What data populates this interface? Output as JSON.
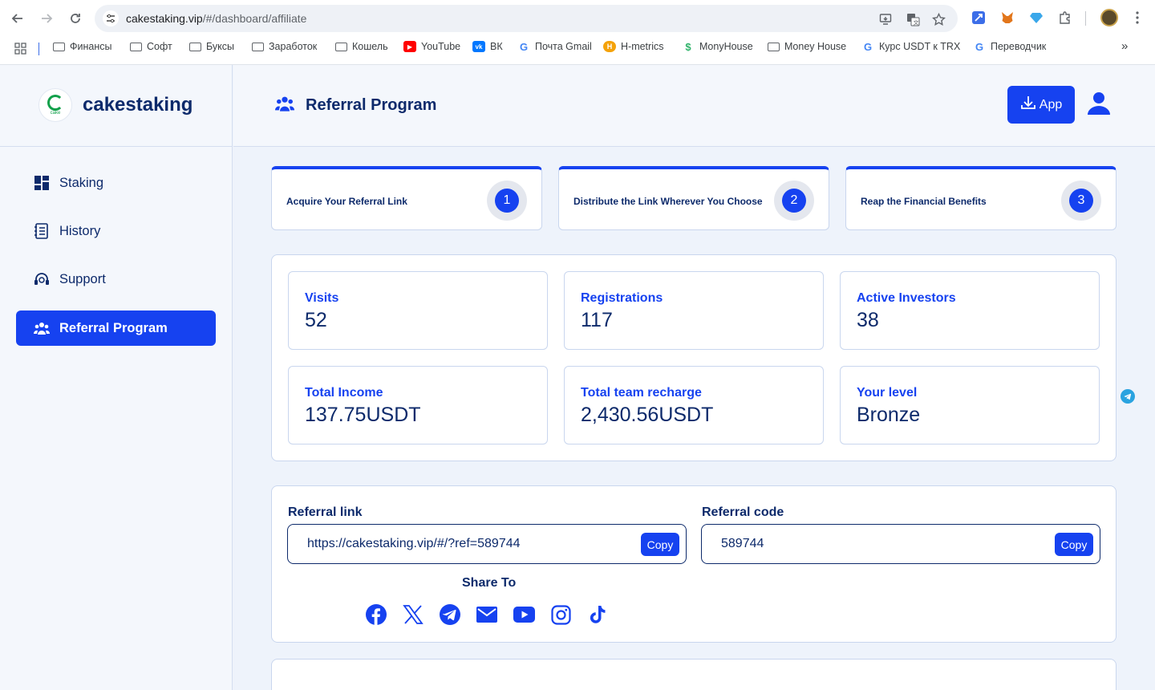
{
  "browser": {
    "url_host": "cakestaking.vip",
    "url_path": "/#/dashboard/affiliate",
    "bookmarks": [
      "Финансы",
      "Софт",
      "Буксы",
      "Заработок",
      "Кошель",
      "YouTube",
      "ВК",
      "Почта Gmail",
      "H-metrics",
      "MonyHouse",
      "Money House",
      "Курс USDT к TRX",
      "Переводчик"
    ],
    "more": "»"
  },
  "brand": {
    "name": "cakestaking",
    "logo_text": "cake"
  },
  "sidebar": {
    "items": [
      {
        "label": "Staking",
        "icon": "dashboard-icon",
        "active": false
      },
      {
        "label": "History",
        "icon": "document-icon",
        "active": false
      },
      {
        "label": "Support",
        "icon": "headset-icon",
        "active": false
      },
      {
        "label": "Referral Program",
        "icon": "users-icon",
        "active": true
      }
    ]
  },
  "header": {
    "title": "Referral Program",
    "app_label": "App"
  },
  "steps": [
    {
      "text": "Acquire Your Referral Link",
      "num": "1"
    },
    {
      "text": "Distribute the Link Wherever You Choose",
      "num": "2"
    },
    {
      "text": "Reap the Financial Benefits",
      "num": "3"
    }
  ],
  "stats": [
    {
      "label": "Visits",
      "value": "52"
    },
    {
      "label": "Registrations",
      "value": "117"
    },
    {
      "label": "Active Investors",
      "value": "38"
    },
    {
      "label": "Total Income",
      "value": "137.75USDT"
    },
    {
      "label": "Total team recharge",
      "value": "2,430.56USDT"
    },
    {
      "label": "Your level",
      "value": "Bronze"
    }
  ],
  "referral": {
    "link_label": "Referral link",
    "link_value": "https://cakestaking.vip/#/?ref=589744",
    "code_label": "Referral code",
    "code_value": "589744",
    "copy_label": "Copy",
    "share_title": "Share To",
    "share_icons": [
      "facebook-icon",
      "x-icon",
      "telegram-icon",
      "mail-icon",
      "youtube-icon",
      "instagram-icon",
      "tiktok-icon"
    ]
  },
  "colors": {
    "accent": "#1642f0",
    "text": "#0d2a6b",
    "background": "#eef3fb"
  }
}
